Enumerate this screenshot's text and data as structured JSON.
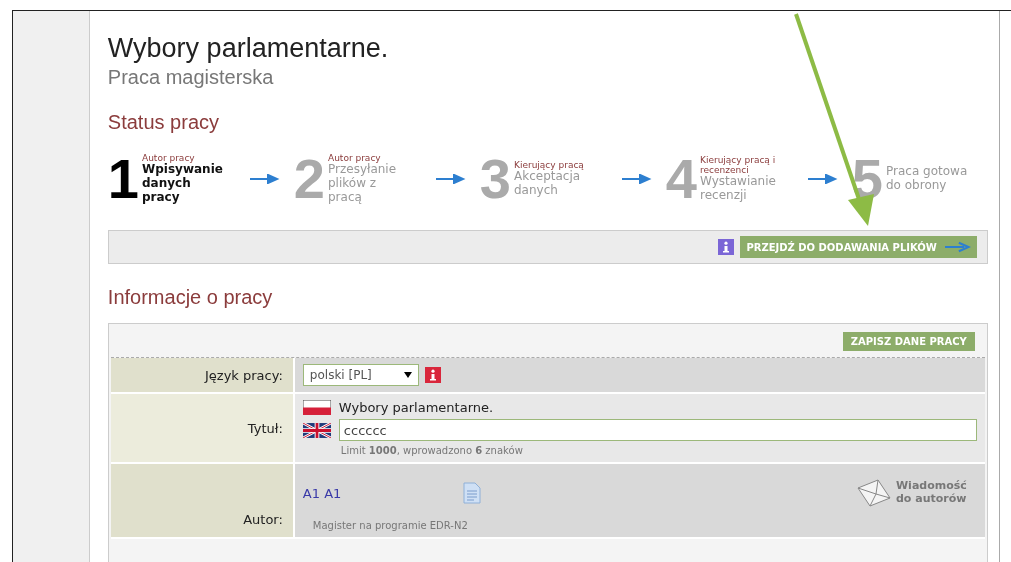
{
  "page": {
    "title": "Wybory parlamentarne.",
    "subtitle": "Praca magisterska"
  },
  "status": {
    "heading": "Status pracy",
    "steps": [
      {
        "number": "1",
        "role": "Autor pracy",
        "label": "Wpisywanie danych pracy",
        "selected": true
      },
      {
        "number": "2",
        "role": "Autor pracy",
        "label": "Przesyłanie plików z pracą",
        "selected": false
      },
      {
        "number": "3",
        "role": "Kierujący pracą",
        "label": "Akceptacja danych",
        "selected": false
      },
      {
        "number": "4",
        "role": "Kierujący pracą i recenzenci",
        "label": "Wystawianie recenzji",
        "selected": false
      },
      {
        "number": "5",
        "label": "Praca gotowa do obrony",
        "selected": false
      }
    ],
    "next_button": "PRZEJDŹ DO DODAWANIA PLIKÓW"
  },
  "info": {
    "heading": "Informacje o pracy",
    "save_button": "ZAPISZ DANE PRACY",
    "language": {
      "label": "Język pracy:",
      "value": "polski [PL]"
    },
    "title": {
      "label": "Tytuł:",
      "polish": "Wybory parlamentarne.",
      "english": "cccccc",
      "note": "Limit **1000**, wprowadzono **6** znaków"
    },
    "author": {
      "label": "Autor:",
      "name": "A1 A1",
      "program": "Magister na programie EDR-N2",
      "message": [
        "Wiadomość",
        "do autorów"
      ]
    }
  }
}
